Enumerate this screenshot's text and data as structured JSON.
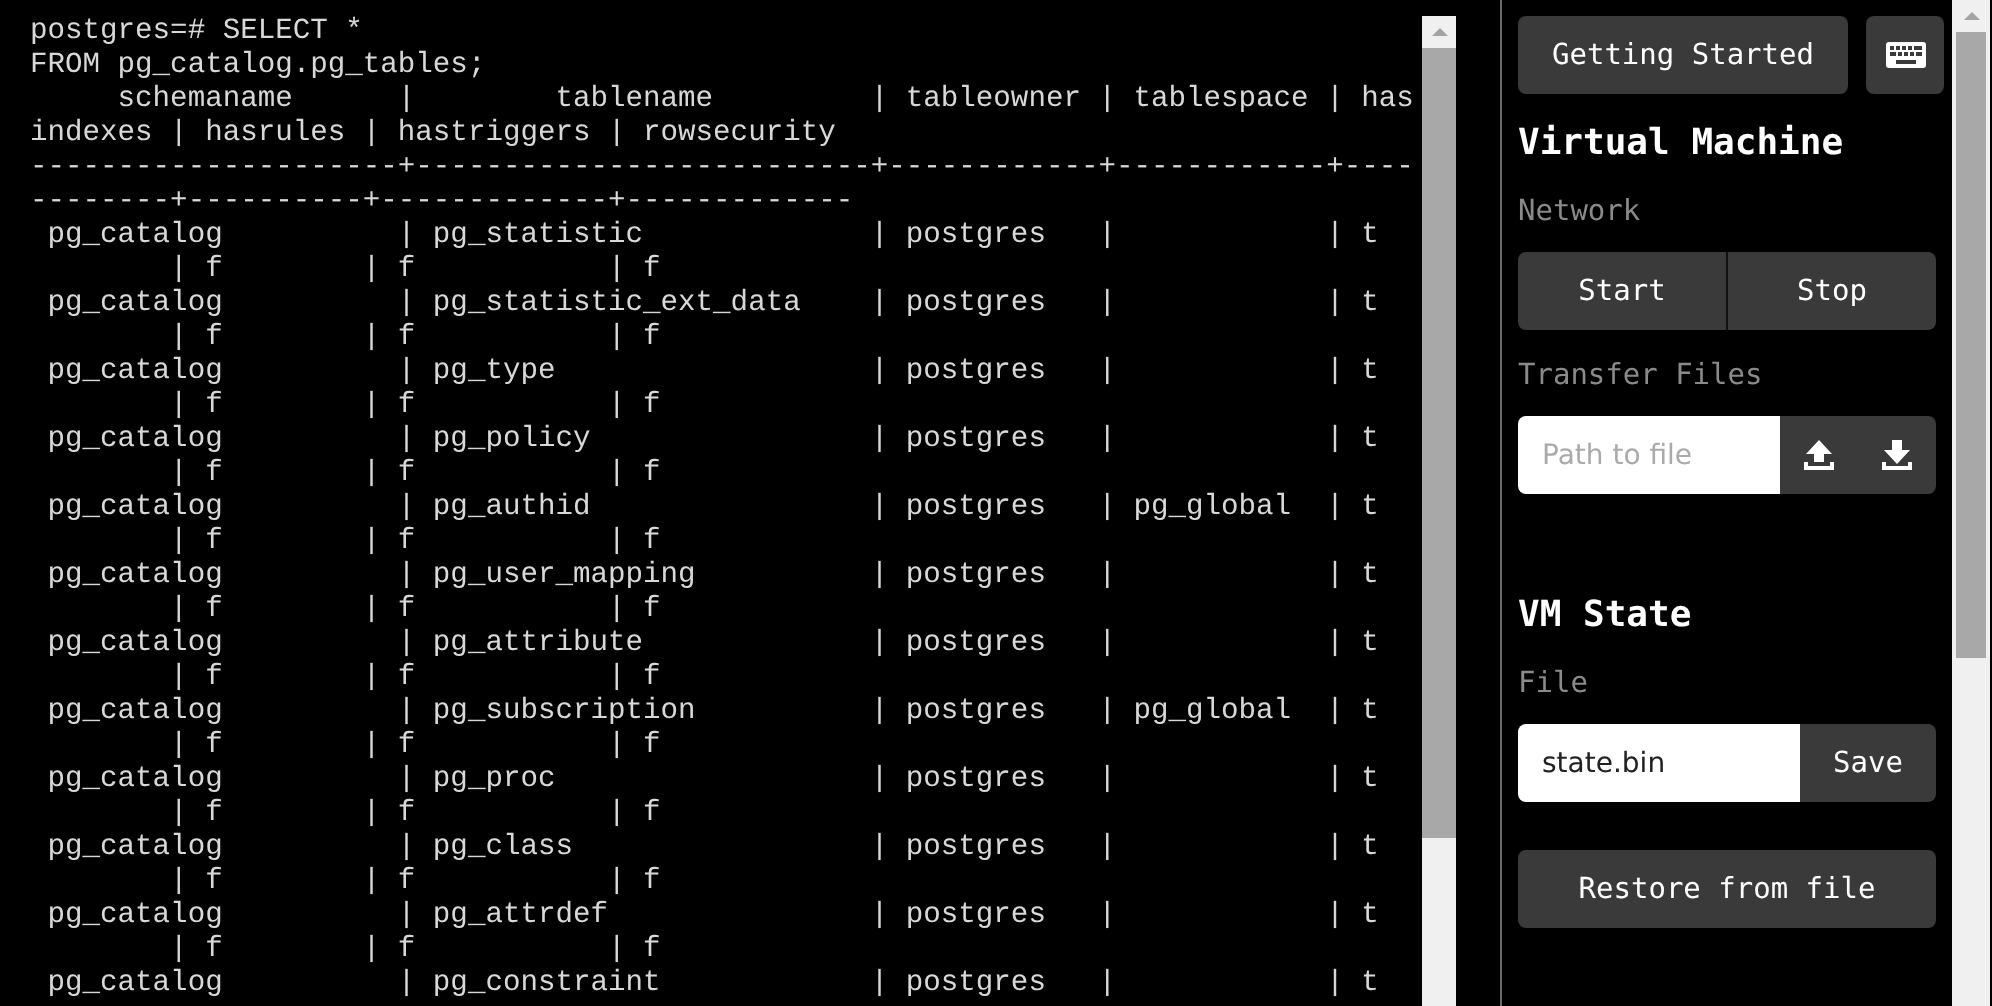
{
  "terminal": {
    "lines": [
      "postgres=# SELECT *",
      "FROM pg_catalog.pg_tables;",
      "     schemaname      |        tablename         | tableowner | tablespace | has",
      "indexes | hasrules | hastriggers | rowsecurity",
      "---------------------+--------------------------+------------+------------+----",
      "--------+----------+-------------+-------------",
      " pg_catalog          | pg_statistic             | postgres   |            | t",
      "        | f        | f           | f",
      " pg_catalog          | pg_statistic_ext_data    | postgres   |            | t",
      "        | f        | f           | f",
      " pg_catalog          | pg_type                  | postgres   |            | t",
      "        | f        | f           | f",
      " pg_catalog          | pg_policy                | postgres   |            | t",
      "        | f        | f           | f",
      " pg_catalog          | pg_authid                | postgres   | pg_global  | t",
      "        | f        | f           | f",
      " pg_catalog          | pg_user_mapping          | postgres   |            | t",
      "        | f        | f           | f",
      " pg_catalog          | pg_attribute             | postgres   |            | t",
      "        | f        | f           | f",
      " pg_catalog          | pg_subscription          | postgres   | pg_global  | t",
      "        | f        | f           | f",
      " pg_catalog          | pg_proc                  | postgres   |            | t",
      "        | f        | f           | f",
      " pg_catalog          | pg_class                 | postgres   |            | t",
      "        | f        | f           | f",
      " pg_catalog          | pg_attrdef               | postgres   |            | t",
      "        | f        | f           | f",
      " pg_catalog          | pg_constraint            | postgres   |            | t"
    ]
  },
  "sidebar": {
    "top_buttons": [
      {
        "kind": "text",
        "label": "Getting Started"
      },
      {
        "kind": "keyboard"
      }
    ],
    "sections": [
      {
        "heading": "Virtual Machine",
        "groups": [
          {
            "kind": "button-pair",
            "label": "Network",
            "buttons": [
              "Start",
              "Stop"
            ]
          },
          {
            "kind": "transfer",
            "label": "Transfer Files",
            "placeholder": "Path to file"
          }
        ]
      },
      {
        "heading": "VM State",
        "groups": [
          {
            "kind": "save",
            "label": "File",
            "value": "state.bin",
            "button": "Save"
          },
          {
            "kind": "wide-button",
            "button": "Restore from file"
          }
        ]
      }
    ]
  }
}
